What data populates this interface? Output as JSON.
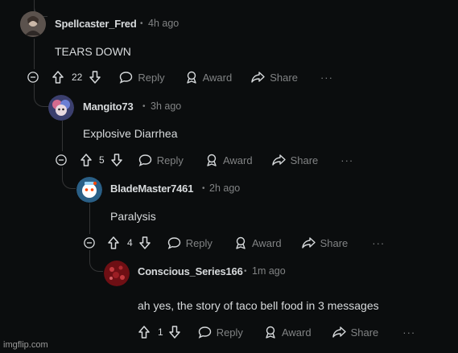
{
  "comments": [
    {
      "username": "Spellcaster_Fred",
      "time": "4h ago",
      "body": "TEARS DOWN",
      "votes": "22",
      "avatar_icon": "user-avatar-icon"
    },
    {
      "username": "Mangito73",
      "time": "3h ago",
      "body": "Explosive Diarrhea",
      "votes": "5",
      "avatar_icon": "user-avatar-icon"
    },
    {
      "username": "BladeMaster7461",
      "time": "2h ago",
      "body": "Paralysis",
      "votes": "4",
      "avatar_icon": "user-avatar-icon"
    },
    {
      "username": "Conscious_Series166",
      "time": "1m ago",
      "body": "ah yes, the story of taco bell food in 3 messages",
      "votes": "1",
      "avatar_icon": "user-avatar-icon"
    }
  ],
  "actions": {
    "reply": "Reply",
    "award": "Award",
    "share": "Share",
    "more": "···",
    "separator": "•"
  },
  "watermark": "imgflip.com",
  "colors": {
    "background": "#0b0d0e",
    "text": "#d7dadc",
    "muted": "#818384",
    "thread_line": "#343536"
  }
}
